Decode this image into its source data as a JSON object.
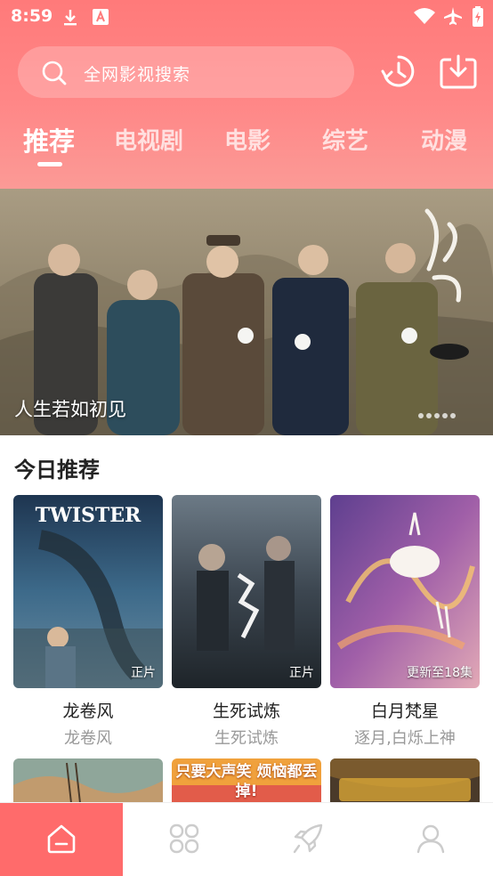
{
  "status_bar": {
    "time": "8:59"
  },
  "search": {
    "placeholder": "全网影视搜索"
  },
  "tabs": [
    {
      "label": "推荐",
      "active": true
    },
    {
      "label": "电视剧"
    },
    {
      "label": "电影"
    },
    {
      "label": "综艺"
    },
    {
      "label": "动漫"
    }
  ],
  "banner": {
    "title": "人生若如初见",
    "slides": 5,
    "active_slide": 1
  },
  "section": {
    "title": "今日推荐"
  },
  "cards": [
    {
      "title": "龙卷风",
      "subtitle": "龙卷风",
      "badge": "正片",
      "poster_text": "TWISTER"
    },
    {
      "title": "生死试炼",
      "subtitle": "生死试炼",
      "badge": "正片"
    },
    {
      "title": "白月梵星",
      "subtitle": "逐月,白烁上神",
      "badge": "更新至18集"
    }
  ],
  "row2_cards": [
    {
      "poster_text": ""
    },
    {
      "poster_text": "只要大声笑 烦恼都丢掉!"
    },
    {
      "poster_text": ""
    }
  ],
  "bottom_nav": [
    {
      "icon": "home-icon",
      "active": true
    },
    {
      "icon": "category-icon"
    },
    {
      "icon": "rocket-icon"
    },
    {
      "icon": "profile-icon"
    }
  ],
  "colors": {
    "accent": "#ff6b6b",
    "header_top": "#ff7a7a",
    "header_bottom": "#fb9a96"
  }
}
